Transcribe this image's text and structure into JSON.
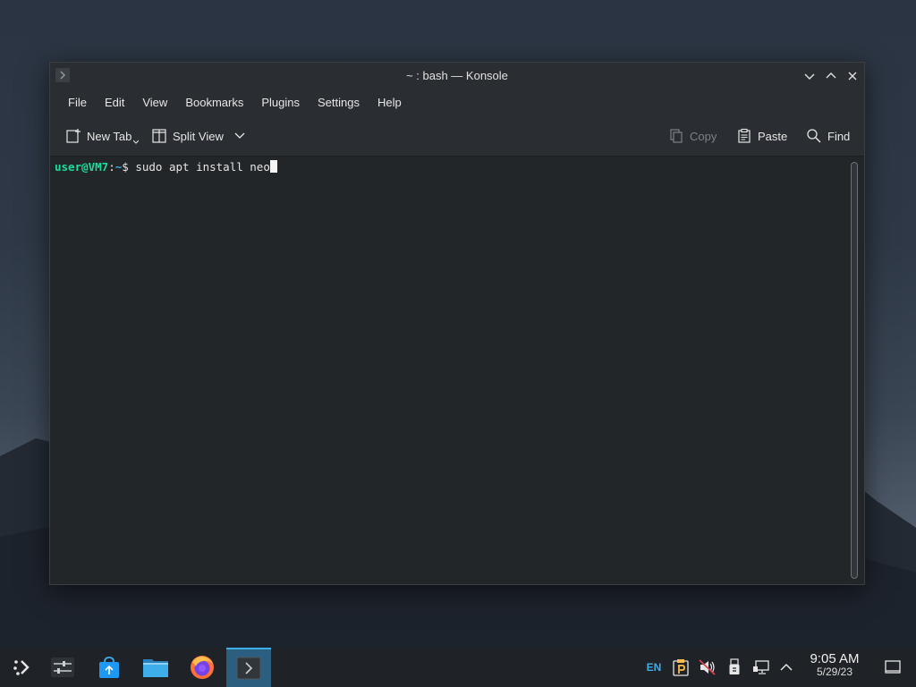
{
  "window": {
    "title": "~ : bash — Konsole",
    "menus": [
      "File",
      "Edit",
      "View",
      "Bookmarks",
      "Plugins",
      "Settings",
      "Help"
    ],
    "toolbar": {
      "new_tab": "New Tab",
      "split_view": "Split View",
      "copy": "Copy",
      "paste": "Paste",
      "find": "Find"
    }
  },
  "terminal": {
    "prompt_user": "user@VM7",
    "prompt_sep": ":",
    "prompt_path": "~",
    "prompt_symbol": "$ ",
    "command": "sudo apt install neo"
  },
  "taskbar": {
    "apps": [
      "application-launcher-icon",
      "system-settings-icon",
      "discover-store-icon",
      "file-manager-icon",
      "firefox-icon",
      "konsole-icon"
    ],
    "active_app": "konsole-icon",
    "tray": {
      "language": "EN",
      "time": "9:05 AM",
      "date": "5/29/23"
    }
  },
  "colors": {
    "accent": "#3daee9",
    "prompt_user": "#1cdc9a",
    "terminal_bg": "#232629"
  }
}
